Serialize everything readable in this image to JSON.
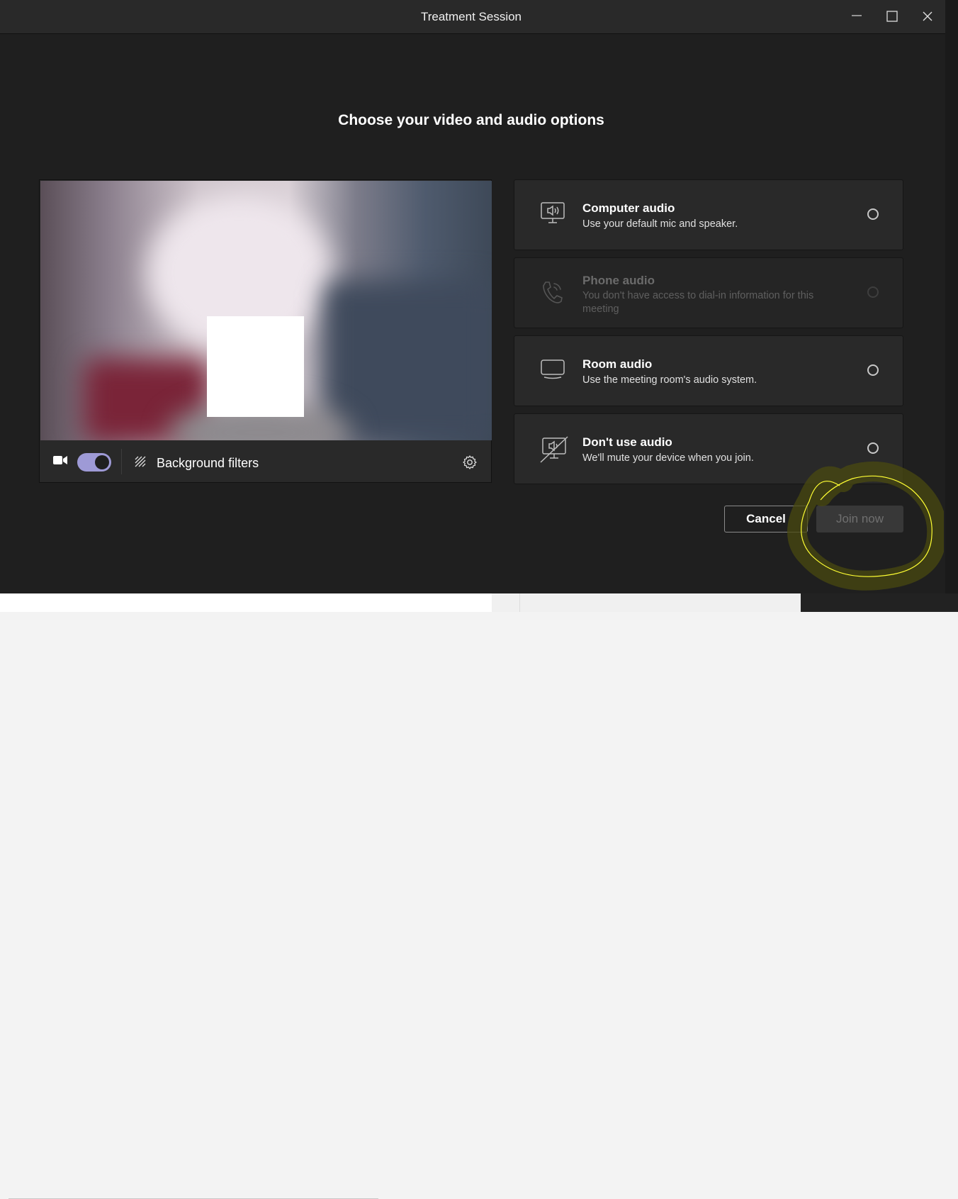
{
  "window": {
    "title": "Treatment Session"
  },
  "heading": "Choose your video and audio options",
  "video": {
    "camera_on": true,
    "background_filters_label": "Background filters"
  },
  "audio_options": [
    {
      "title": "Computer audio",
      "description": "Use your default mic and speaker.",
      "icon": "computer-speaker-icon",
      "enabled": true,
      "selected": false
    },
    {
      "title": "Phone audio",
      "description": "You don't have access to dial-in information for this meeting",
      "icon": "phone-icon",
      "enabled": false,
      "selected": false
    },
    {
      "title": "Room audio",
      "description": "Use the meeting room's audio system.",
      "icon": "room-display-icon",
      "enabled": true,
      "selected": false
    },
    {
      "title": "Don't use audio",
      "description": "We'll mute your device when you join.",
      "icon": "audio-off-icon",
      "enabled": true,
      "selected": false
    }
  ],
  "buttons": {
    "cancel": "Cancel",
    "join": "Join now"
  },
  "colors": {
    "accent": "#9e9ad6",
    "annotation": "#ffff33"
  }
}
